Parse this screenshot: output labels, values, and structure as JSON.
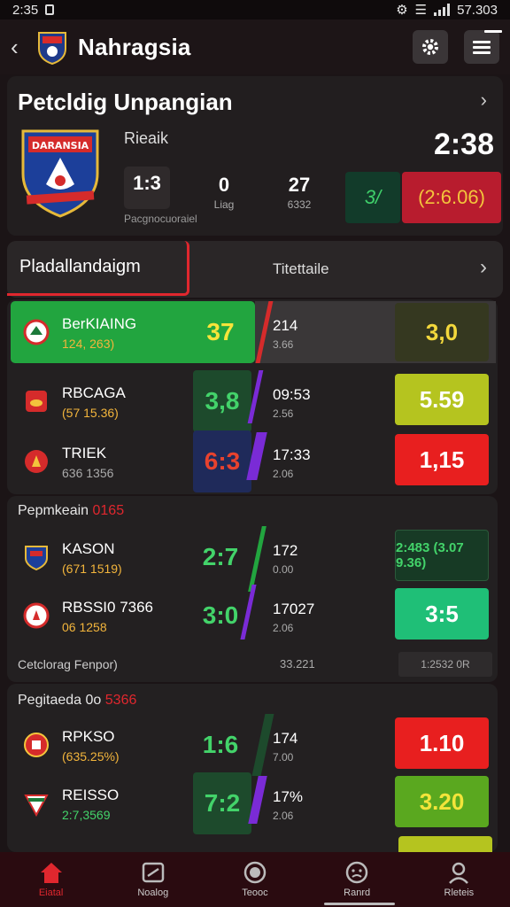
{
  "status": {
    "time": "2:35",
    "battery": "57.303"
  },
  "header": {
    "title": "Nahragsia"
  },
  "hero": {
    "title": "Petcldig Unpangian",
    "crest_text": "DARANSIA",
    "label": "Rieaik",
    "score": "2:38",
    "stats": [
      {
        "value": "1:3",
        "label": ""
      },
      {
        "value": "0",
        "label": "Liag"
      },
      {
        "value": "27",
        "label": "6332"
      }
    ],
    "footnote": "Pacgnocuoraiel",
    "odd_a": "3/",
    "odd_b": "(2:6.06)"
  },
  "tabs": {
    "active": "Pladallandaigm",
    "other": "Titettaile"
  },
  "groups": [
    {
      "heading": "",
      "heading_red": "",
      "rows": [
        {
          "name": "BerKIAING",
          "sub": "124, 263)",
          "score": "37",
          "mid": "214",
          "mid_sub": "3.66",
          "odd": "3,0"
        },
        {
          "name": "RBCAGA",
          "sub": "(57 15.36)",
          "score": "3,8",
          "mid": "09:53",
          "mid_sub": "2.56",
          "odd": "5.59"
        },
        {
          "name": "TRIEK",
          "sub": "636 1356",
          "score": "6:3",
          "mid": "17:33",
          "mid_sub": "2.06",
          "odd": "1,15"
        }
      ]
    },
    {
      "heading": "Pepmkeain",
      "heading_red": "0165",
      "rows": [
        {
          "name": "KASON",
          "sub": "(671 1519)",
          "score": "2:7",
          "mid": "172",
          "mid_sub": "0.00",
          "odd": "2:483 (3.07 9.36)"
        },
        {
          "name": "RBSSI0 7366",
          "sub": "06 1258",
          "score": "3:0",
          "mid": "17027",
          "mid_sub": "2.06",
          "odd": "3:5"
        }
      ],
      "footer": {
        "label": "Cetclorag Fenpor)",
        "mid": "33.221",
        "box": "1:2532 0R"
      }
    },
    {
      "heading": "Pegitaeda 0o",
      "heading_red": "5366",
      "rows": [
        {
          "name": "RPKSO",
          "sub": "(635.25%)",
          "score": "1:6",
          "mid": "174",
          "mid_sub": "7.00",
          "odd": "1.10"
        },
        {
          "name": "REISSO",
          "sub": "2:7,3569",
          "score": "7:2",
          "mid": "17%",
          "mid_sub": "2.06",
          "odd": "3.20"
        }
      ]
    }
  ],
  "nav": [
    {
      "label": "Eiatal",
      "icon": "home-icon"
    },
    {
      "label": "Noalog",
      "icon": "ticket-icon"
    },
    {
      "label": "Teooc",
      "icon": "ball-icon"
    },
    {
      "label": "Ranrd",
      "icon": "face-icon"
    },
    {
      "label": "Rleteis",
      "icon": "profile-icon"
    }
  ],
  "colors": {
    "accent": "#e0272e",
    "green": "#22a53f",
    "yellow": "#b5c41f",
    "red": "#e81f1f"
  }
}
